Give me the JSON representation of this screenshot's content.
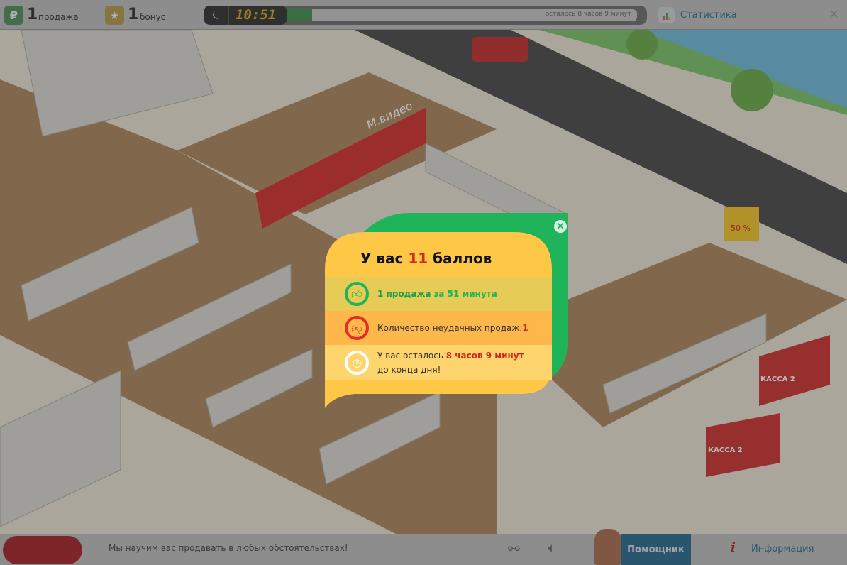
{
  "topbar": {
    "sales_count": "1",
    "sales_label": "продажа",
    "bonus_count": "1",
    "bonus_label": "бонус",
    "clock": "10:51",
    "progress_percent": 8,
    "remaining_text": "осталось 8 часов 9 минут",
    "stats_label": "Статистика",
    "close": "×"
  },
  "popup": {
    "title_prefix": "У вас ",
    "title_points": "11",
    "title_suffix": " баллов",
    "row1_a": "1 продажа ",
    "row1_b": "за 51 минута",
    "row2_a": "Количество неудачных продаж: ",
    "row2_b": "1",
    "row3_a": "У вас осталось ",
    "row3_b": "8 часов 9 минут",
    "row3_c": "до конца дня!",
    "close": "×"
  },
  "bottombar": {
    "tagline": "Мы научим вас продавать в любых обстоятельствах!",
    "helper_label": "Помощник",
    "info_label": "Информация",
    "info_icon": "i"
  },
  "scene": {
    "sign_brand": "М.видео",
    "cashier_1": "КАССА 2",
    "cashier_2": "КАССА 2",
    "sale_tag": "50 %"
  }
}
